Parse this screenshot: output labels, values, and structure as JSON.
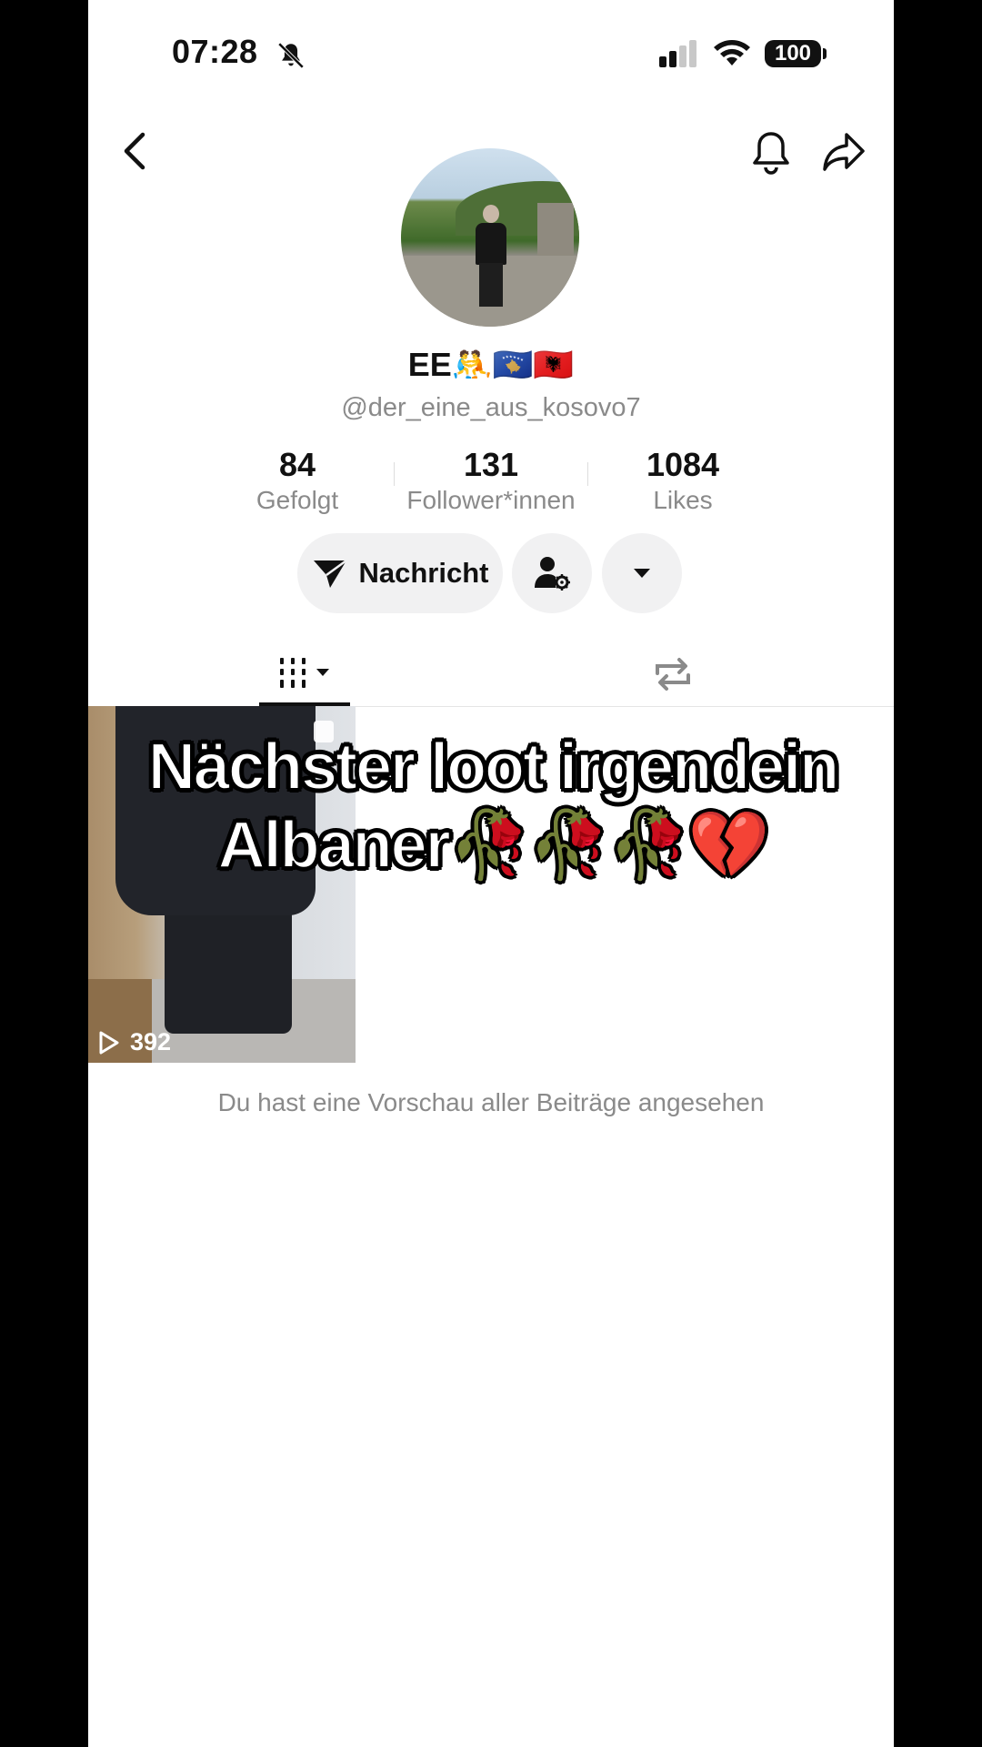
{
  "status_bar": {
    "time": "07:28",
    "battery": "100",
    "icons": [
      "mute-bell-icon",
      "signal-icon",
      "wifi-icon",
      "battery-icon"
    ]
  },
  "header": {
    "icons": [
      "back-icon",
      "bell-icon",
      "share-icon"
    ]
  },
  "profile": {
    "display_name": "EE🤼🇽🇰🇦🇱",
    "username": "@der_eine_aus_kosovo7",
    "stats": [
      {
        "value": "84",
        "label": "Gefolgt"
      },
      {
        "value": "131",
        "label": "Follower*innen"
      },
      {
        "value": "1084",
        "label": "Likes"
      }
    ]
  },
  "actions": {
    "message_label": "Nachricht",
    "icons": [
      "send-icon",
      "user-settings-icon",
      "dropdown-icon"
    ]
  },
  "tabs": {
    "icons": [
      "grid-icon",
      "repost-icon"
    ],
    "active": "grid"
  },
  "video": {
    "caption": "Nächster loot irgendein Albaner🥀🥀🥀💔",
    "views": "392"
  },
  "footer_note": "Du hast eine Vorschau aller Beiträge angesehen",
  "colors": {
    "text_primary": "#111111",
    "text_secondary": "#8a8a8a",
    "button_bg": "#f1f1f2"
  }
}
